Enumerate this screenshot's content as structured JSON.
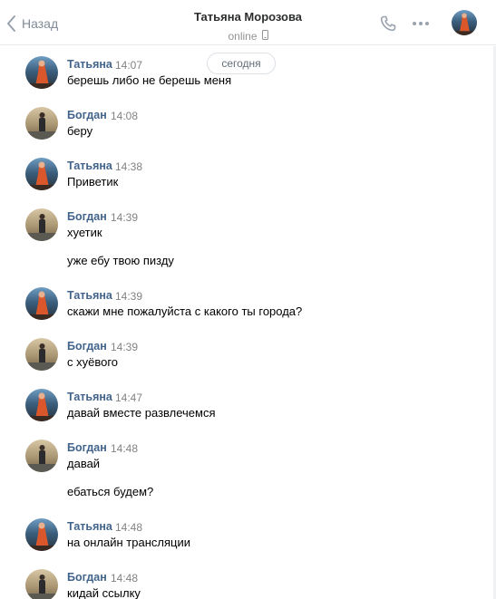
{
  "header": {
    "back_label": "Назад",
    "title": "Татьяна Морозова",
    "status": "online"
  },
  "date_divider": "сегодня",
  "messages": [
    {
      "author": "Татьяна",
      "time": "14:07",
      "lines": [
        "берешь либо не берешь меня"
      ]
    },
    {
      "author": "Богдан",
      "time": "14:08",
      "lines": [
        "беру"
      ]
    },
    {
      "author": "Татьяна",
      "time": "14:38",
      "lines": [
        "Приветик"
      ]
    },
    {
      "author": "Богдан",
      "time": "14:39",
      "lines": [
        "хуетик",
        "уже ебу твою пизду"
      ]
    },
    {
      "author": "Татьяна",
      "time": "14:39",
      "lines": [
        "скажи мне пожалуйста с какого ты города?"
      ]
    },
    {
      "author": "Богдан",
      "time": "14:39",
      "lines": [
        "с хуёвого"
      ]
    },
    {
      "author": "Татьяна",
      "time": "14:47",
      "lines": [
        "давай вместе развлечемся"
      ]
    },
    {
      "author": "Богдан",
      "time": "14:48",
      "lines": [
        "давай",
        "ебаться будем?"
      ]
    },
    {
      "author": "Татьяна",
      "time": "14:48",
      "lines": [
        "на онлайн трансляции"
      ]
    },
    {
      "author": "Богдан",
      "time": "14:48",
      "lines": [
        "кидай ссылку"
      ]
    }
  ],
  "colors": {
    "author": "#42648b",
    "muted": "#828282",
    "divider": "#e7e8ec"
  },
  "icons": [
    "chevron-left-icon",
    "mobile-icon",
    "phone-icon",
    "more-icon"
  ]
}
